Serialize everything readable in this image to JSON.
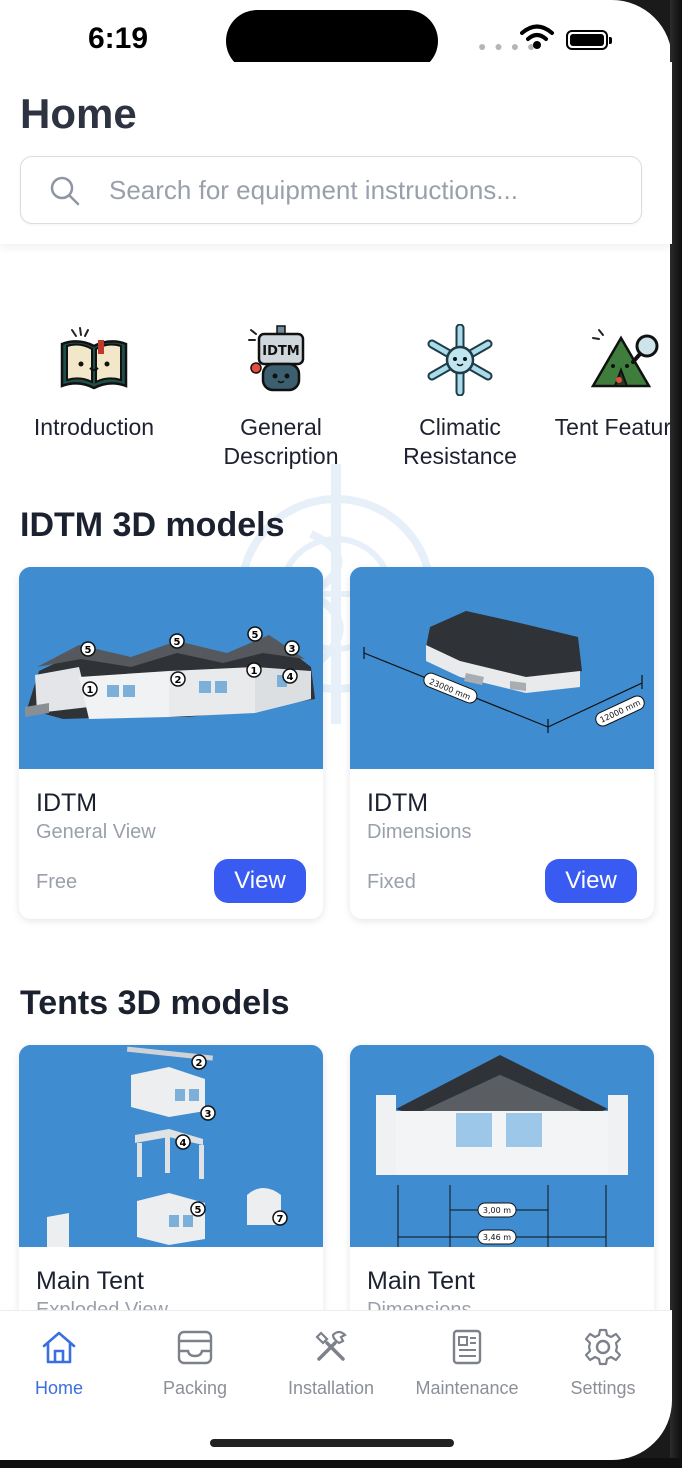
{
  "status_bar": {
    "time": "6:19"
  },
  "header": {
    "title": "Home",
    "search": {
      "placeholder": "Search for equipment instructions...",
      "value": ""
    }
  },
  "categories": [
    {
      "label": "Introduction",
      "icon": "open-book-icon"
    },
    {
      "label": "General Description",
      "icon": "idtm-robot-icon"
    },
    {
      "label": "Climatic Resistance",
      "icon": "snowflake-icon"
    },
    {
      "label": "Tent Features",
      "icon": "tent-magnifier-icon"
    }
  ],
  "sections": [
    {
      "title": "IDTM 3D models",
      "cards": [
        {
          "title": "IDTM",
          "subtitle": "General View",
          "tag": "Free",
          "button": "View",
          "markers": [
            "5",
            "5",
            "5",
            "3",
            "1",
            "2",
            "1",
            "4"
          ]
        },
        {
          "title": "IDTM",
          "subtitle": "Dimensions",
          "tag": "Fixed",
          "button": "View",
          "dims": [
            "23000 mm",
            "12000 mm"
          ]
        }
      ]
    },
    {
      "title": "Tents 3D models",
      "cards": [
        {
          "title": "Main Tent",
          "subtitle": "Exploded View",
          "markers": [
            "2",
            "3",
            "4",
            "5",
            "7"
          ]
        },
        {
          "title": "Main Tent",
          "subtitle": "Dimensions",
          "dims": [
            "3,00 m",
            "3,46 m"
          ]
        }
      ]
    }
  ],
  "tabs": [
    {
      "label": "Home",
      "icon": "home-icon",
      "active": true
    },
    {
      "label": "Packing",
      "icon": "inbox-tray-icon",
      "active": false
    },
    {
      "label": "Installation",
      "icon": "tools-icon",
      "active": false
    },
    {
      "label": "Maintenance",
      "icon": "newspaper-icon",
      "active": false
    },
    {
      "label": "Settings",
      "icon": "gear-icon",
      "active": false
    }
  ],
  "colors": {
    "accent": "#3a5bf2",
    "tab_active": "#3b6fe0",
    "thumb_bg": "#3f8dd0"
  }
}
